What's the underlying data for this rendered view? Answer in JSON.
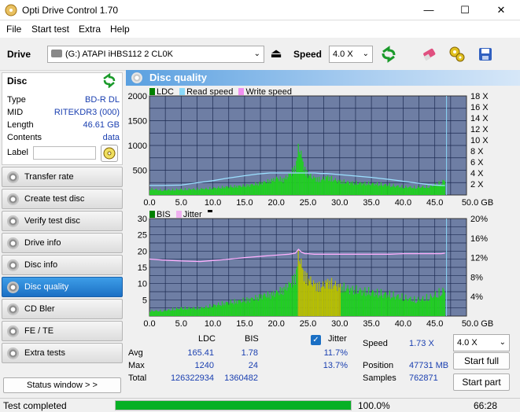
{
  "window": {
    "title": "Opti Drive Control 1.70",
    "min": "—",
    "max": "☐",
    "close": "✕"
  },
  "menu": [
    "File",
    "Start test",
    "Extra",
    "Help"
  ],
  "toolbar": {
    "drive_label": "Drive",
    "drive_value": "(G:)   ATAPI iHBS112   2 CL0K",
    "speed_label": "Speed",
    "speed_value": "4.0 X"
  },
  "disc": {
    "header": "Disc",
    "rows": [
      {
        "k": "Type",
        "v": "BD-R DL"
      },
      {
        "k": "MID",
        "v": "RITEKDR3 (000)"
      },
      {
        "k": "Length",
        "v": "46.61 GB"
      },
      {
        "k": "Contents",
        "v": "data"
      },
      {
        "k": "Label",
        "v": ""
      }
    ]
  },
  "nav": [
    "Transfer rate",
    "Create test disc",
    "Verify test disc",
    "Drive info",
    "Disc info",
    "Disc quality",
    "CD Bler",
    "FE / TE",
    "Extra tests"
  ],
  "nav_active": "Disc quality",
  "status_window_btn": "Status window > >",
  "panel_title": "Disc quality",
  "legend_top": [
    "LDC",
    "Read speed",
    "Write speed"
  ],
  "legend_bottom": [
    "BIS",
    "Jitter"
  ],
  "colors": {
    "ldc": "#00c000",
    "read": "#6ad0f0",
    "write": "#ff80ff",
    "bis": "#00c000",
    "jitter": "#ffb0ff",
    "plot_bg": "#6e7ea4",
    "accent": "#1a6fc4"
  },
  "chart_data": [
    {
      "type": "area",
      "x": [
        0,
        2,
        5,
        8,
        10,
        12,
        15,
        17,
        18,
        19,
        20,
        21,
        22,
        23,
        23.5,
        24,
        24.5,
        25,
        26,
        27,
        28,
        29,
        30,
        32,
        35,
        38,
        40,
        42,
        44,
        45,
        46,
        46.6
      ],
      "series": [
        {
          "name": "LDC",
          "values": [
            150,
            120,
            140,
            150,
            170,
            200,
            230,
            280,
            320,
            350,
            420,
            380,
            500,
            700,
            1240,
            900,
            600,
            500,
            420,
            380,
            450,
            380,
            340,
            300,
            280,
            240,
            200,
            190,
            210,
            250,
            300,
            380
          ]
        },
        {
          "name": "Read speed",
          "values": [
            1.73,
            1.73,
            1.8,
            2.3,
            2.6,
            3.0,
            3.5,
            3.8,
            3.9,
            4.0,
            4.0,
            4.0,
            4.0,
            4.0,
            4.0,
            4.0,
            4.0,
            4.0,
            4.0,
            3.9,
            3.9,
            3.8,
            3.7,
            3.5,
            3.2,
            2.8,
            2.5,
            2.2,
            1.9,
            1.8,
            1.75,
            1.73
          ]
        }
      ],
      "xlim": [
        0,
        50
      ],
      "ylim": [
        0,
        2000
      ],
      "ylim_right": [
        0,
        18
      ],
      "xticks": [
        "0.0",
        "5.0",
        "10.0",
        "15.0",
        "20.0",
        "25.0",
        "30.0",
        "35.0",
        "40.0",
        "45.0",
        "50.0 GB"
      ],
      "yticks": [
        "500",
        "1000",
        "1500",
        "2000"
      ],
      "yticks_right": [
        "2 X",
        "4 X",
        "6 X",
        "8 X",
        "10 X",
        "12 X",
        "14 X",
        "16 X",
        "18 X"
      ]
    },
    {
      "type": "area",
      "x": [
        0,
        2,
        5,
        8,
        10,
        12,
        15,
        17,
        18,
        19,
        20,
        21,
        22,
        23,
        23.5,
        24,
        24.5,
        25,
        26,
        27,
        28,
        29,
        30,
        32,
        35,
        38,
        40,
        42,
        44,
        45,
        46,
        46.6
      ],
      "series": [
        {
          "name": "BIS",
          "values": [
            2,
            2,
            3,
            3,
            4,
            5,
            6,
            7,
            8,
            8,
            9,
            10,
            12,
            15,
            24,
            18,
            15,
            14,
            12,
            11,
            13,
            12,
            11,
            10,
            9,
            8,
            7,
            6,
            7,
            8,
            9,
            10
          ]
        },
        {
          "name": "Jitter",
          "values": [
            11.7,
            11.5,
            11.3,
            11.2,
            11.4,
            11.6,
            12.0,
            12.2,
            12.3,
            12.4,
            12.5,
            12.6,
            12.7,
            12.9,
            13.7,
            13.1,
            12.8,
            12.8,
            12.7,
            12.7,
            12.7,
            12.7,
            12.7,
            12.7,
            12.7,
            12.7,
            12.8,
            12.8,
            12.8,
            12.8,
            12.8,
            12.9
          ]
        }
      ],
      "xlim": [
        0,
        50
      ],
      "ylim": [
        0,
        30
      ],
      "ylim_right": [
        0,
        20
      ],
      "xticks": [
        "0.0",
        "5.0",
        "10.0",
        "15.0",
        "20.0",
        "25.0",
        "30.0",
        "35.0",
        "40.0",
        "45.0",
        "50.0 GB"
      ],
      "yticks": [
        "5",
        "10",
        "15",
        "20",
        "25",
        "30"
      ],
      "yticks_right": [
        "4%",
        "8%",
        "12%",
        "16%",
        "20%"
      ]
    }
  ],
  "stats": {
    "col_ldc": "LDC",
    "col_bis": "BIS",
    "col_jitter": "Jitter",
    "row_labels": [
      "Avg",
      "Max",
      "Total"
    ],
    "ldc": [
      "165.41",
      "1240",
      "126322934"
    ],
    "bis": [
      "1.78",
      "24",
      "1360482"
    ],
    "jitter": [
      "11.7%",
      "13.7%",
      ""
    ],
    "speed_label": "Speed",
    "speed_value": "1.73 X",
    "position_label": "Position",
    "position_value": "47731 MB",
    "samples_label": "Samples",
    "samples_value": "762871",
    "speed_select": "4.0 X",
    "start_full": "Start full",
    "start_part": "Start part"
  },
  "status": {
    "text": "Test completed",
    "progress": 1.0,
    "percent": "100.0%",
    "time": "66:28"
  }
}
